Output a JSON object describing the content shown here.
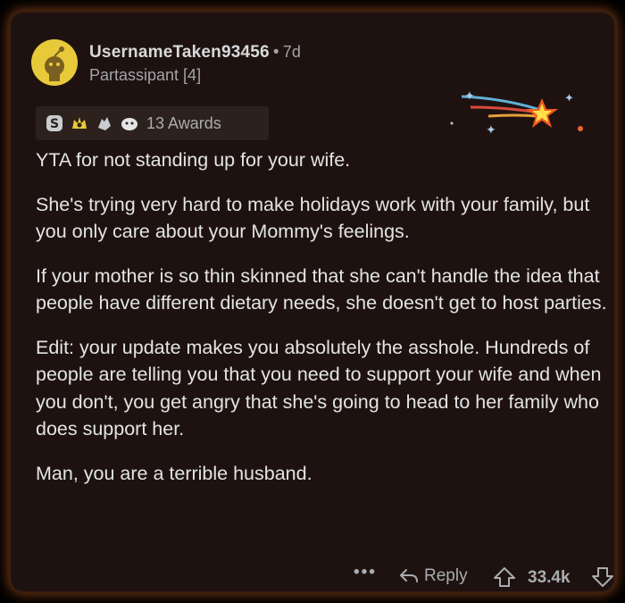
{
  "comment": {
    "username": "UsernameTaken93456",
    "age": "7d",
    "flair": "Partassipant [4]",
    "awards_label": "13 Awards",
    "paragraphs": [
      "YTA for not standing up for your wife.",
      "She's trying very hard to make holidays work with your family, but you only care about your Mommy's feelings.",
      "If your mother is so thin skinned that she can't handle the idea that people have different dietary needs, she doesn't get to host parties.",
      "Edit: your update makes you absolutely the asshole. Hundreds of people are telling you that you need to support your wife and when you don't, you get angry that she's going to head to her family who does support her.",
      "Man, you are a terrible husband."
    ]
  },
  "actions": {
    "more": "•••",
    "reply_label": "Reply",
    "score": "33.4k"
  },
  "icons": [
    "snoo-avatar-icon",
    "award-s-icon",
    "award-crown-icon",
    "award-hands-icon",
    "award-face-icon",
    "award-animation-icon",
    "reply-arrow-icon",
    "upvote-arrow-icon",
    "downvote-arrow-icon"
  ],
  "colors": {
    "background": "#1e1210",
    "glow": "#e66e28",
    "text": "#e2e4e6",
    "meta": "#a0a4a8"
  }
}
